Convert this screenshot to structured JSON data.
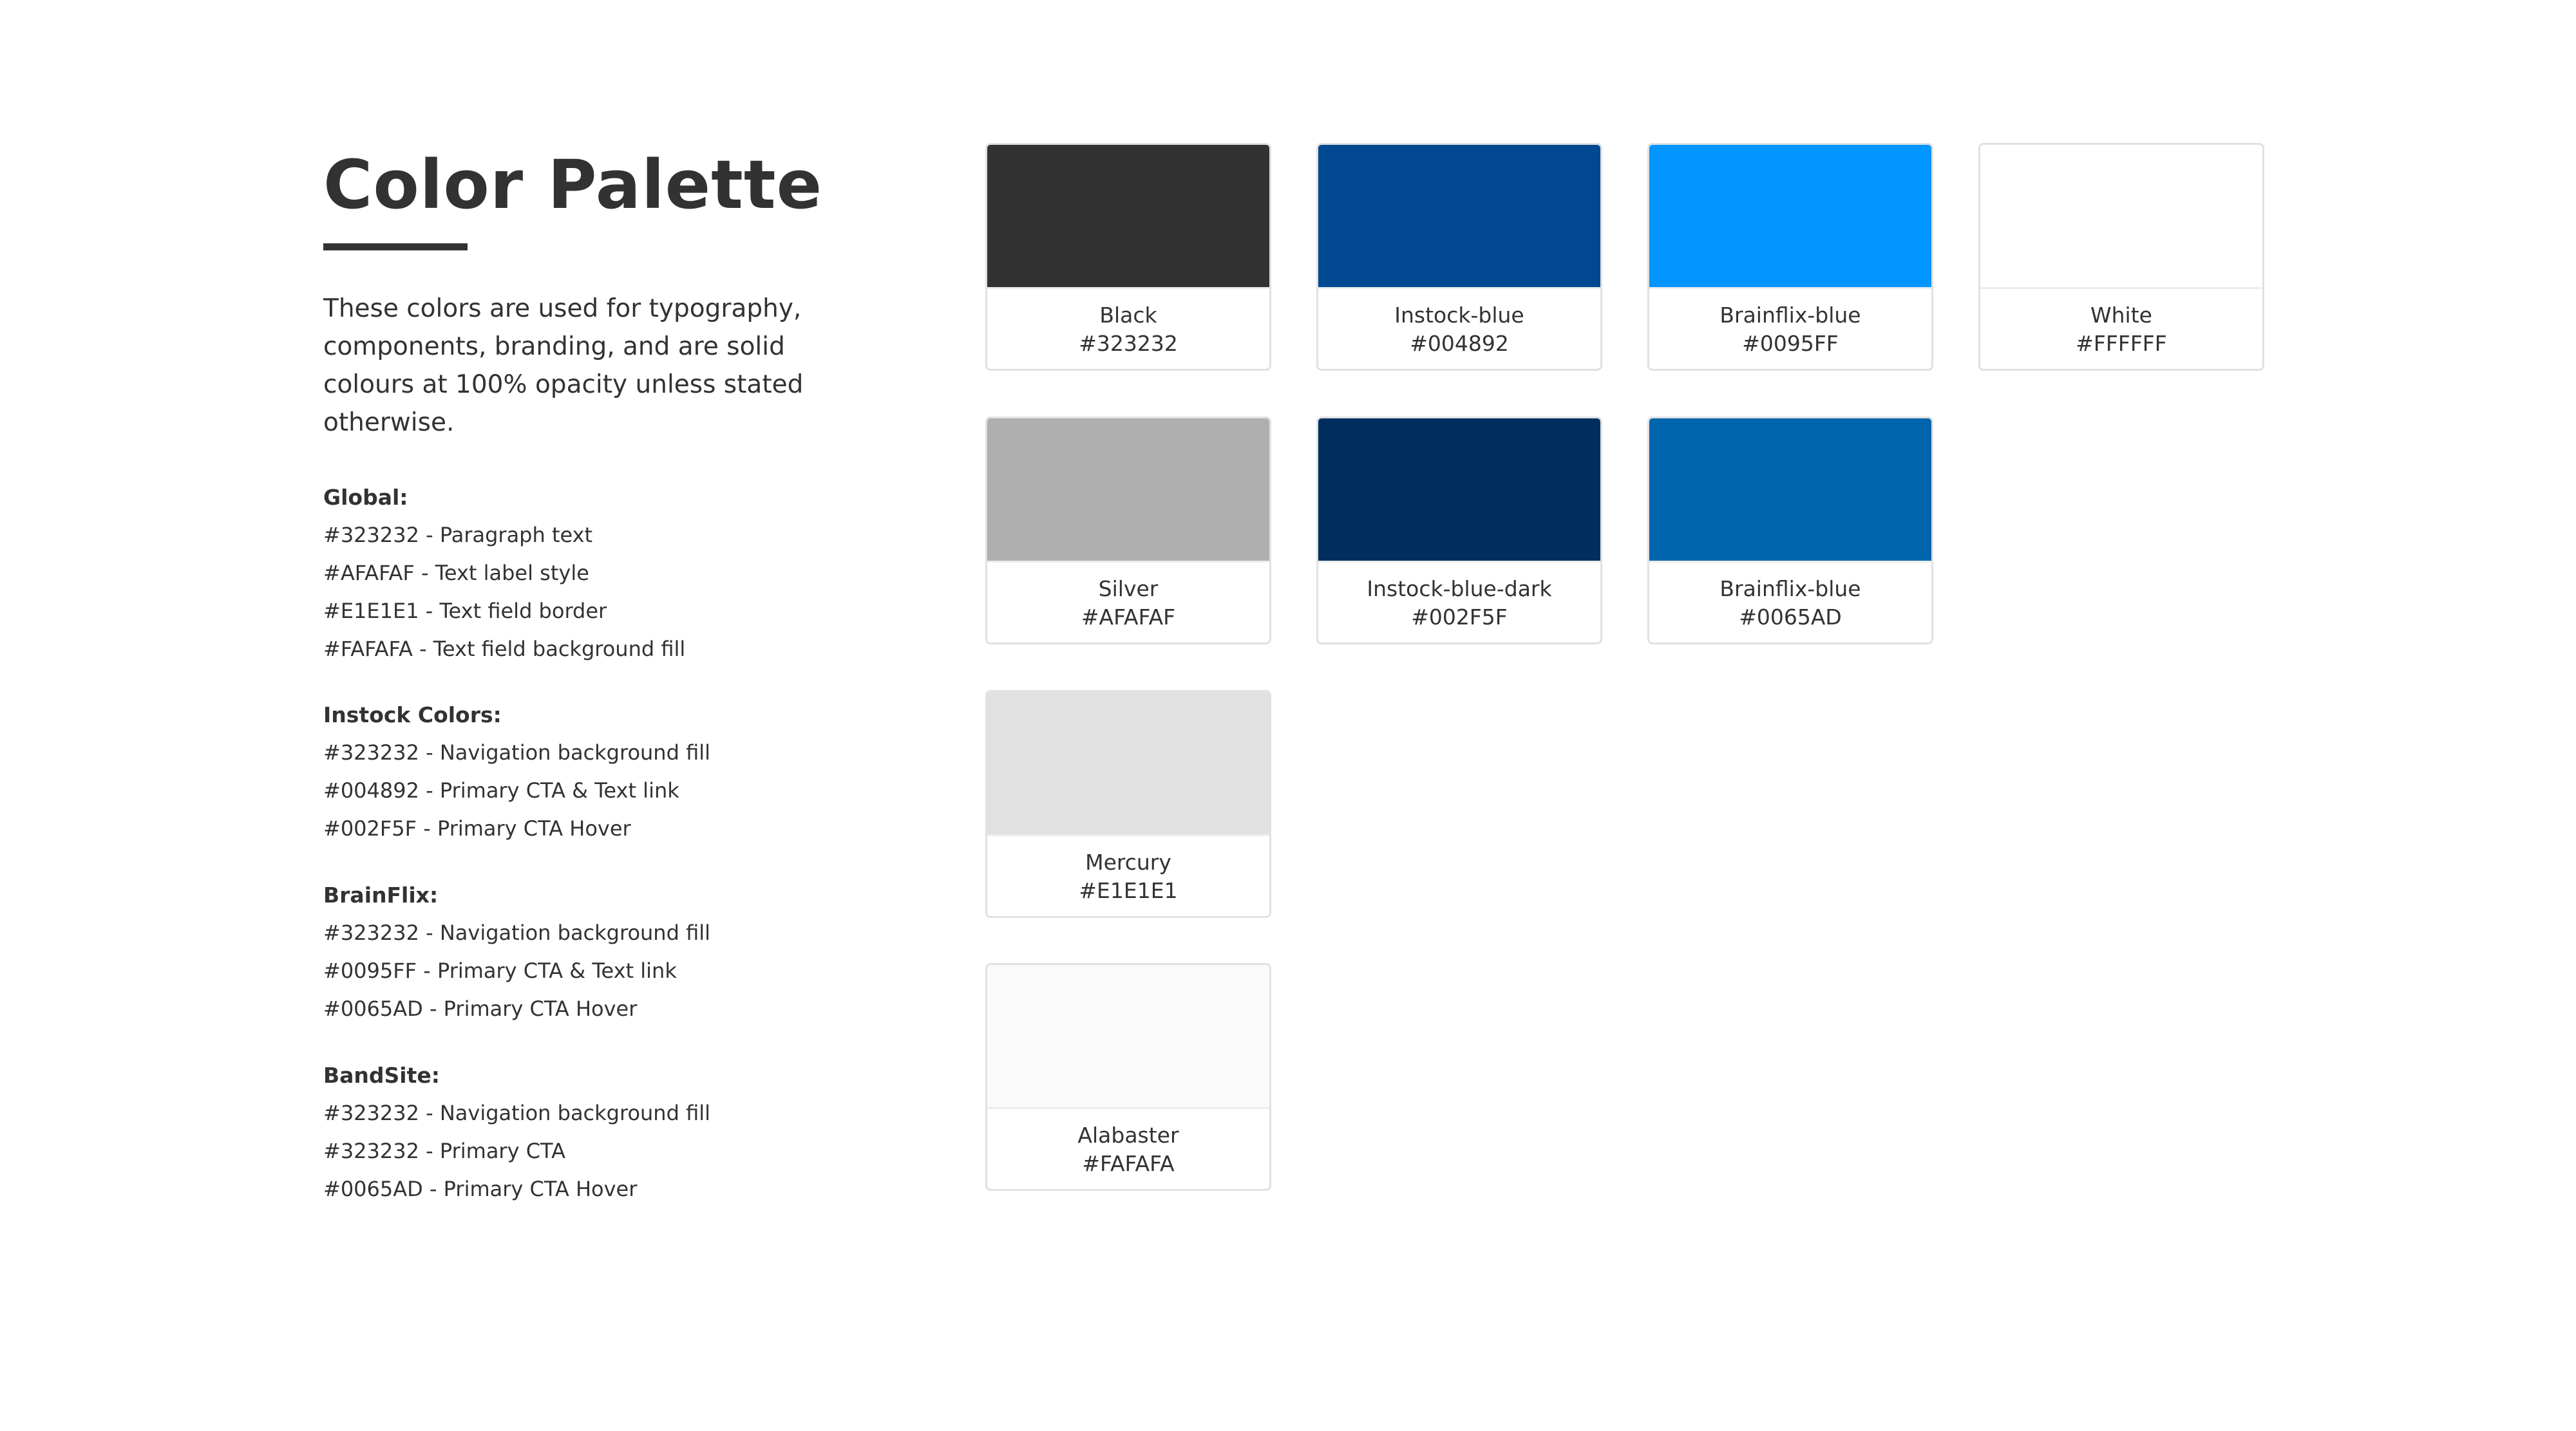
{
  "title": "Color Palette",
  "intro": "These colors are used for typography, components, branding, and are solid colours at 100% opacity unless stated otherwise.",
  "groups": [
    {
      "heading": "Global:",
      "items": [
        "#323232 - Paragraph text",
        "#AFAFAF - Text label style",
        "#E1E1E1 - Text field border",
        "#FAFAFA - Text field background fill"
      ]
    },
    {
      "heading": "Instock Colors:",
      "items": [
        "#323232 - Navigation background fill",
        "#004892 - Primary CTA & Text link",
        "#002F5F - Primary CTA Hover"
      ]
    },
    {
      "heading": "BrainFlix:",
      "items": [
        "#323232 - Navigation background fill",
        "#0095FF - Primary CTA & Text link",
        "#0065AD - Primary CTA Hover"
      ]
    },
    {
      "heading": "BandSite:",
      "items": [
        "#323232 - Navigation background fill",
        "#323232 - Primary CTA",
        "#0065AD - Primary CTA Hover"
      ]
    }
  ],
  "swatches": [
    {
      "name": "Black",
      "hex": "#323232",
      "color": "#323232"
    },
    {
      "name": "Instock-blue",
      "hex": "#004892",
      "color": "#004892"
    },
    {
      "name": "Brainflix-blue",
      "hex": "#0095FF",
      "color": "#0095FF"
    },
    {
      "name": "White",
      "hex": "#FFFFFF",
      "color": "#FFFFFF"
    },
    {
      "name": "Silver",
      "hex": "#AFAFAF",
      "color": "#AFAFAF"
    },
    {
      "name": "Instock-blue-dark",
      "hex": "#002F5F",
      "color": "#002F5F"
    },
    {
      "name": "Brainflix-blue",
      "hex": "#0065AD",
      "color": "#0065AD"
    },
    {
      "name": "Mercury",
      "hex": "#E1E1E1",
      "color": "#E1E1E1"
    },
    {
      "name": "Alabaster",
      "hex": "#FAFAFA",
      "color": "#FAFAFA"
    }
  ]
}
